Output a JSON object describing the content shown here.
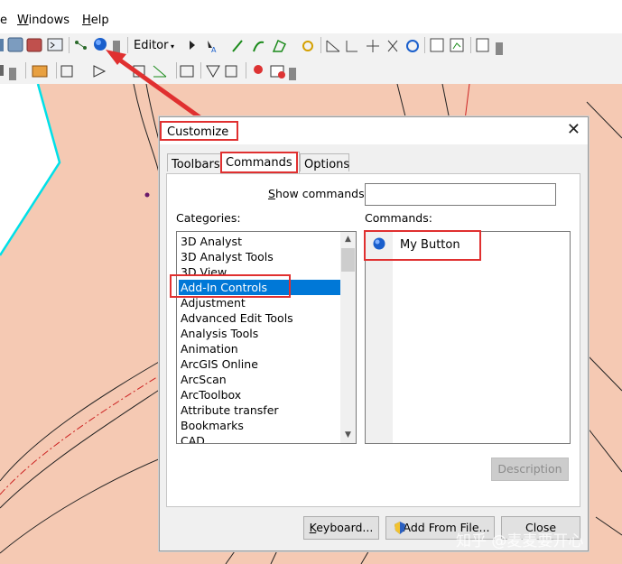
{
  "menubar": {
    "items": [
      {
        "label": "e",
        "mnemonic": ""
      },
      {
        "label": "indows",
        "mnemonic": "W"
      },
      {
        "label": "elp",
        "mnemonic": "H"
      }
    ]
  },
  "toolbar": {
    "editor_label": "Editor"
  },
  "dialog": {
    "title": "Customize",
    "close_glyph": "✕",
    "tabs": [
      {
        "label": "Toolbars"
      },
      {
        "label": "Commands"
      },
      {
        "label": "Options"
      }
    ],
    "show_commands_label": "Show commands",
    "show_commands_value": "",
    "categories_label": "Categories:",
    "commands_label": "Commands:",
    "categories": [
      "3D Analyst",
      "3D Analyst Tools",
      "3D View",
      "Add-In Controls",
      "Adjustment",
      "Advanced Edit Tools",
      "Analysis Tools",
      "Animation",
      "ArcGIS Online",
      "ArcScan",
      "ArcToolbox",
      "Attribute transfer",
      "Bookmarks",
      "CAD"
    ],
    "selected_category": "Add-In Controls",
    "commands": [
      {
        "label": "My Button",
        "icon": "blue-sphere-icon"
      }
    ],
    "description_button": "Description",
    "keyboard_button": "Keyboard...",
    "add_from_file_button": "Add From File...",
    "close_button": "Close"
  },
  "watermark": "知乎 @麦麦要开心",
  "colors": {
    "map_background": "#f5c9b3",
    "highlight_red": "#e03030",
    "selection_blue": "#0078d7",
    "cyan_line": "#00e0e8"
  }
}
